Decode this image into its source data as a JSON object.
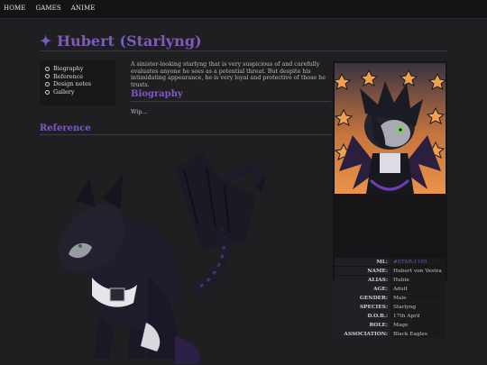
{
  "nav": {
    "items": [
      {
        "label": "HOME"
      },
      {
        "label": "GAMES"
      },
      {
        "label": "ANIME"
      }
    ]
  },
  "page": {
    "title_icon": "✦",
    "title": "Hubert (Starlyng)"
  },
  "toc": {
    "items": [
      {
        "label": "Biography"
      },
      {
        "label": "Reference"
      },
      {
        "label": "Design notes"
      },
      {
        "label": "Gallery"
      }
    ]
  },
  "intro": "A sinister-looking starlyng that is very suspicious of and carefully evaluates anyone he sees as a potential threat. But despite his intimidating appearance, he is very loyal and protective of those he trusts.",
  "sections": {
    "biography": "Biography",
    "biography_text": "Wip...",
    "reference": "Reference"
  },
  "infobox": {
    "rows": [
      {
        "key": "ML:",
        "value": "#STAR-1165",
        "link": true
      },
      {
        "key": "NAME:",
        "value": "Hubert von Vestra"
      },
      {
        "key": "ALIAS:",
        "value": "Hubie"
      },
      {
        "key": "AGE:",
        "value": "Adult"
      },
      {
        "key": "GENDER:",
        "value": "Male"
      },
      {
        "key": "SPECIES:",
        "value": "Starlyng"
      },
      {
        "key": "D.O.B.:",
        "value": "17th April"
      },
      {
        "key": "ROLE:",
        "value": "Mage"
      },
      {
        "key": "ASSOCIATION:",
        "value": "Black Eagles"
      }
    ]
  },
  "colors": {
    "accent": "#7c5bbf",
    "background": "#1f1f22",
    "topbar": "#141416"
  }
}
